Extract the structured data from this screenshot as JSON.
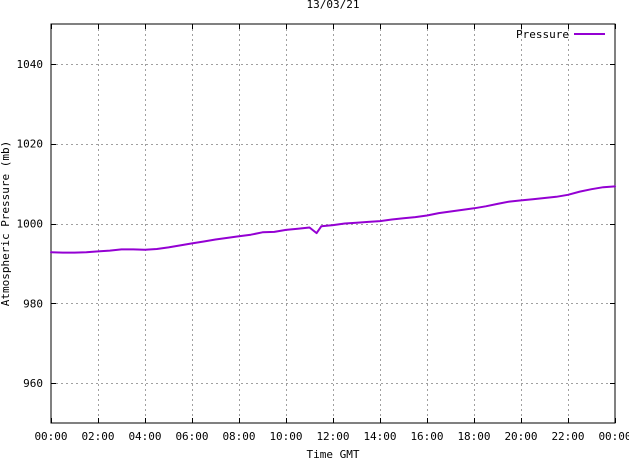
{
  "chart_data": {
    "type": "line",
    "title": "13/03/21",
    "xlabel": "Time GMT",
    "ylabel": "Atmospheric Pressure (mb)",
    "xlim": [
      0,
      24
    ],
    "ylim": [
      950,
      1050
    ],
    "x_ticks": [
      {
        "value": 0,
        "label": "00:00"
      },
      {
        "value": 2,
        "label": "02:00"
      },
      {
        "value": 4,
        "label": "04:00"
      },
      {
        "value": 6,
        "label": "06:00"
      },
      {
        "value": 8,
        "label": "08:00"
      },
      {
        "value": 10,
        "label": "10:00"
      },
      {
        "value": 12,
        "label": "12:00"
      },
      {
        "value": 14,
        "label": "14:00"
      },
      {
        "value": 16,
        "label": "16:00"
      },
      {
        "value": 18,
        "label": "18:00"
      },
      {
        "value": 20,
        "label": "20:00"
      },
      {
        "value": 22,
        "label": "22:00"
      },
      {
        "value": 24,
        "label": "00:00"
      }
    ],
    "y_ticks": [
      {
        "value": 960,
        "label": "960"
      },
      {
        "value": 980,
        "label": "980"
      },
      {
        "value": 1000,
        "label": "1000"
      },
      {
        "value": 1020,
        "label": "1020"
      },
      {
        "value": 1040,
        "label": "1040"
      }
    ],
    "grid": true,
    "legend_position": "top-right",
    "series": [
      {
        "name": "Pressure",
        "color": "#9400d3",
        "x": [
          0,
          0.5,
          1,
          1.5,
          2,
          2.5,
          3,
          3.5,
          4,
          4.5,
          5,
          5.5,
          6,
          6.5,
          7,
          7.5,
          8,
          8.5,
          9,
          9.5,
          10,
          10.5,
          11,
          11.3,
          11.5,
          12,
          12.5,
          13,
          13.5,
          14,
          14.5,
          15,
          15.5,
          16,
          16.5,
          17,
          17.5,
          18,
          18.5,
          19,
          19.5,
          20,
          20.5,
          21,
          21.5,
          22,
          22.5,
          23,
          23.5,
          24
        ],
        "y": [
          992.8,
          992.7,
          992.7,
          992.8,
          993.0,
          993.2,
          993.5,
          993.5,
          993.4,
          993.6,
          994.0,
          994.5,
          995.0,
          995.5,
          996.0,
          996.4,
          996.8,
          997.2,
          997.8,
          997.9,
          998.4,
          998.7,
          999.0,
          997.6,
          999.3,
          999.6,
          1000.0,
          1000.2,
          1000.4,
          1000.6,
          1001.0,
          1001.3,
          1001.6,
          1002.0,
          1002.6,
          1003.0,
          1003.4,
          1003.8,
          1004.3,
          1004.9,
          1005.5,
          1005.8,
          1006.1,
          1006.4,
          1006.7,
          1007.2,
          1008.0,
          1008.6,
          1009.1,
          1009.3
        ]
      }
    ]
  }
}
